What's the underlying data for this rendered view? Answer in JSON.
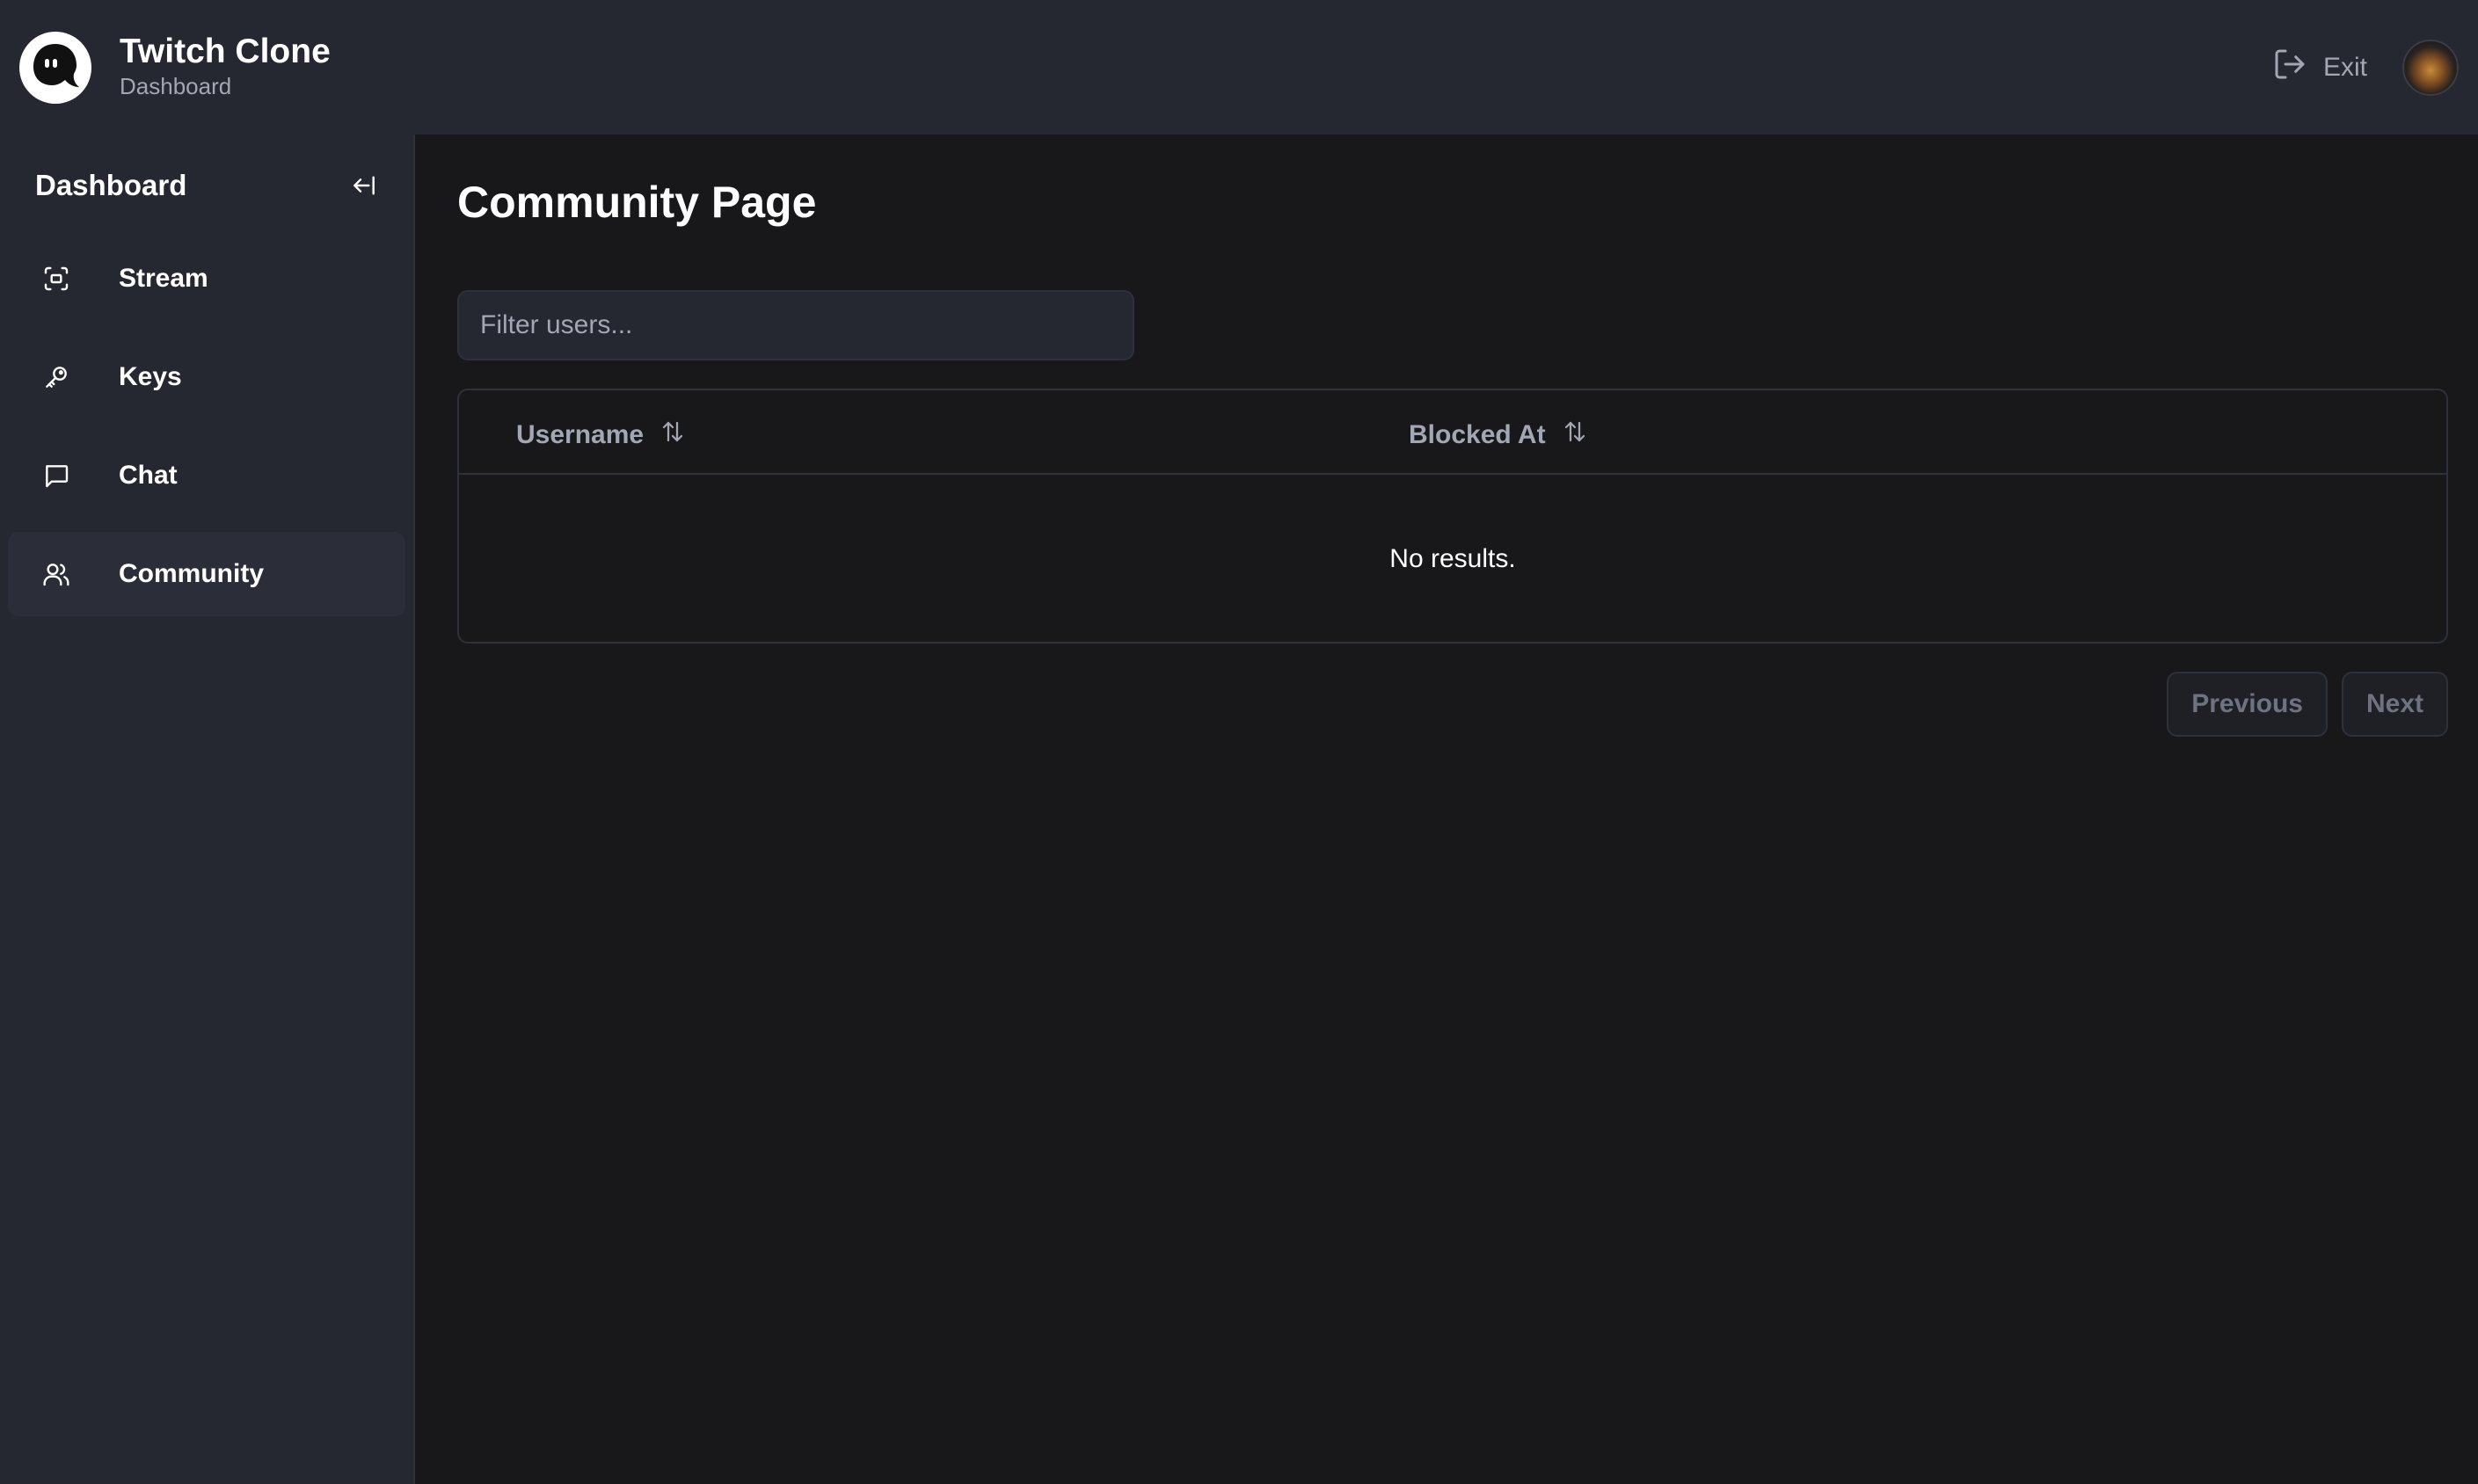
{
  "header": {
    "app_title": "Twitch Clone",
    "app_subtitle": "Dashboard",
    "exit_label": "Exit"
  },
  "sidebar": {
    "title": "Dashboard",
    "items": [
      {
        "label": "Stream",
        "icon": "stream-icon",
        "active": false
      },
      {
        "label": "Keys",
        "icon": "key-icon",
        "active": false
      },
      {
        "label": "Chat",
        "icon": "chat-icon",
        "active": false
      },
      {
        "label": "Community",
        "icon": "users-icon",
        "active": true
      }
    ]
  },
  "main": {
    "page_title": "Community Page",
    "filter": {
      "placeholder": "Filter users...",
      "value": ""
    },
    "table": {
      "columns": [
        "Username",
        "Blocked At"
      ],
      "rows": [],
      "empty_text": "No results."
    },
    "pagination": {
      "previous_label": "Previous",
      "next_label": "Next"
    }
  },
  "colors": {
    "topbar_bg": "#252731",
    "main_bg": "#18181a",
    "muted_text": "#a3a6b3",
    "active_nav_bg": "#2b2e39"
  }
}
